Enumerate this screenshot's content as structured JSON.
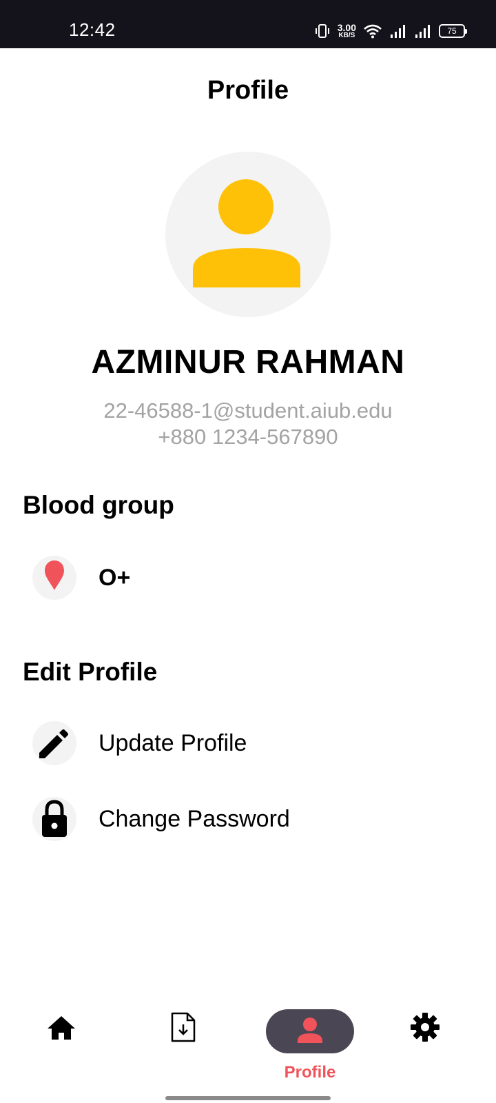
{
  "status_bar": {
    "time": "12:42",
    "net_speed": "3.00",
    "net_unit": "KB/S",
    "battery": "75"
  },
  "header": {
    "title": "Profile"
  },
  "user": {
    "name": "AZMINUR RAHMAN",
    "email": "22-46588-1@student.aiub.edu",
    "phone": "+880 1234-567890"
  },
  "blood_group": {
    "section_title": "Blood group",
    "value": "O+",
    "icon": "blood-drop-icon"
  },
  "edit_profile": {
    "section_title": "Edit Profile",
    "items": [
      {
        "label": "Update Profile",
        "icon": "pencil-icon"
      },
      {
        "label": "Change Password",
        "icon": "lock-icon"
      }
    ]
  },
  "bottom_nav": {
    "items": [
      {
        "icon": "home-icon"
      },
      {
        "icon": "download-file-icon"
      },
      {
        "icon": "person-icon",
        "label": "Profile",
        "active": true
      },
      {
        "icon": "gear-icon"
      }
    ]
  },
  "colors": {
    "accent_yellow": "#FFC107",
    "accent_red": "#F0545A",
    "status_bar_bg": "#14131B",
    "active_pill": "#4B4654",
    "muted_text": "#A3A3A3"
  }
}
